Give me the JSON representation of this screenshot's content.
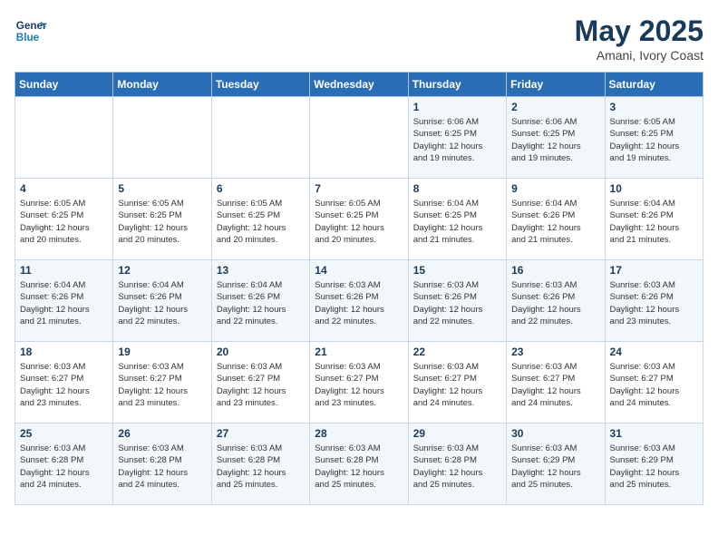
{
  "header": {
    "logo_line1": "General",
    "logo_line2": "Blue",
    "month": "May 2025",
    "location": "Amani, Ivory Coast"
  },
  "weekdays": [
    "Sunday",
    "Monday",
    "Tuesday",
    "Wednesday",
    "Thursday",
    "Friday",
    "Saturday"
  ],
  "weeks": [
    [
      {
        "day": "",
        "info": ""
      },
      {
        "day": "",
        "info": ""
      },
      {
        "day": "",
        "info": ""
      },
      {
        "day": "",
        "info": ""
      },
      {
        "day": "1",
        "info": "Sunrise: 6:06 AM\nSunset: 6:25 PM\nDaylight: 12 hours\nand 19 minutes."
      },
      {
        "day": "2",
        "info": "Sunrise: 6:06 AM\nSunset: 6:25 PM\nDaylight: 12 hours\nand 19 minutes."
      },
      {
        "day": "3",
        "info": "Sunrise: 6:05 AM\nSunset: 6:25 PM\nDaylight: 12 hours\nand 19 minutes."
      }
    ],
    [
      {
        "day": "4",
        "info": "Sunrise: 6:05 AM\nSunset: 6:25 PM\nDaylight: 12 hours\nand 20 minutes."
      },
      {
        "day": "5",
        "info": "Sunrise: 6:05 AM\nSunset: 6:25 PM\nDaylight: 12 hours\nand 20 minutes."
      },
      {
        "day": "6",
        "info": "Sunrise: 6:05 AM\nSunset: 6:25 PM\nDaylight: 12 hours\nand 20 minutes."
      },
      {
        "day": "7",
        "info": "Sunrise: 6:05 AM\nSunset: 6:25 PM\nDaylight: 12 hours\nand 20 minutes."
      },
      {
        "day": "8",
        "info": "Sunrise: 6:04 AM\nSunset: 6:25 PM\nDaylight: 12 hours\nand 21 minutes."
      },
      {
        "day": "9",
        "info": "Sunrise: 6:04 AM\nSunset: 6:26 PM\nDaylight: 12 hours\nand 21 minutes."
      },
      {
        "day": "10",
        "info": "Sunrise: 6:04 AM\nSunset: 6:26 PM\nDaylight: 12 hours\nand 21 minutes."
      }
    ],
    [
      {
        "day": "11",
        "info": "Sunrise: 6:04 AM\nSunset: 6:26 PM\nDaylight: 12 hours\nand 21 minutes."
      },
      {
        "day": "12",
        "info": "Sunrise: 6:04 AM\nSunset: 6:26 PM\nDaylight: 12 hours\nand 22 minutes."
      },
      {
        "day": "13",
        "info": "Sunrise: 6:04 AM\nSunset: 6:26 PM\nDaylight: 12 hours\nand 22 minutes."
      },
      {
        "day": "14",
        "info": "Sunrise: 6:03 AM\nSunset: 6:26 PM\nDaylight: 12 hours\nand 22 minutes."
      },
      {
        "day": "15",
        "info": "Sunrise: 6:03 AM\nSunset: 6:26 PM\nDaylight: 12 hours\nand 22 minutes."
      },
      {
        "day": "16",
        "info": "Sunrise: 6:03 AM\nSunset: 6:26 PM\nDaylight: 12 hours\nand 22 minutes."
      },
      {
        "day": "17",
        "info": "Sunrise: 6:03 AM\nSunset: 6:26 PM\nDaylight: 12 hours\nand 23 minutes."
      }
    ],
    [
      {
        "day": "18",
        "info": "Sunrise: 6:03 AM\nSunset: 6:27 PM\nDaylight: 12 hours\nand 23 minutes."
      },
      {
        "day": "19",
        "info": "Sunrise: 6:03 AM\nSunset: 6:27 PM\nDaylight: 12 hours\nand 23 minutes."
      },
      {
        "day": "20",
        "info": "Sunrise: 6:03 AM\nSunset: 6:27 PM\nDaylight: 12 hours\nand 23 minutes."
      },
      {
        "day": "21",
        "info": "Sunrise: 6:03 AM\nSunset: 6:27 PM\nDaylight: 12 hours\nand 23 minutes."
      },
      {
        "day": "22",
        "info": "Sunrise: 6:03 AM\nSunset: 6:27 PM\nDaylight: 12 hours\nand 24 minutes."
      },
      {
        "day": "23",
        "info": "Sunrise: 6:03 AM\nSunset: 6:27 PM\nDaylight: 12 hours\nand 24 minutes."
      },
      {
        "day": "24",
        "info": "Sunrise: 6:03 AM\nSunset: 6:27 PM\nDaylight: 12 hours\nand 24 minutes."
      }
    ],
    [
      {
        "day": "25",
        "info": "Sunrise: 6:03 AM\nSunset: 6:28 PM\nDaylight: 12 hours\nand 24 minutes."
      },
      {
        "day": "26",
        "info": "Sunrise: 6:03 AM\nSunset: 6:28 PM\nDaylight: 12 hours\nand 24 minutes."
      },
      {
        "day": "27",
        "info": "Sunrise: 6:03 AM\nSunset: 6:28 PM\nDaylight: 12 hours\nand 25 minutes."
      },
      {
        "day": "28",
        "info": "Sunrise: 6:03 AM\nSunset: 6:28 PM\nDaylight: 12 hours\nand 25 minutes."
      },
      {
        "day": "29",
        "info": "Sunrise: 6:03 AM\nSunset: 6:28 PM\nDaylight: 12 hours\nand 25 minutes."
      },
      {
        "day": "30",
        "info": "Sunrise: 6:03 AM\nSunset: 6:29 PM\nDaylight: 12 hours\nand 25 minutes."
      },
      {
        "day": "31",
        "info": "Sunrise: 6:03 AM\nSunset: 6:29 PM\nDaylight: 12 hours\nand 25 minutes."
      }
    ]
  ]
}
